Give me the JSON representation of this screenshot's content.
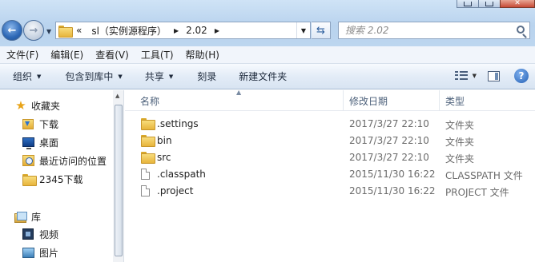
{
  "addressbar": {
    "overflow": "«",
    "crumbs": [
      "sl（实例源程序）",
      "2.02"
    ]
  },
  "search": {
    "placeholder": "搜索 2.02"
  },
  "menu": [
    "文件(F)",
    "编辑(E)",
    "查看(V)",
    "工具(T)",
    "帮助(H)"
  ],
  "commands": {
    "organize": "组织",
    "include_in_library": "包含到库中",
    "share": "共享",
    "burn": "刻录",
    "new_folder": "新建文件夹"
  },
  "nav": {
    "favorites": "收藏夹",
    "downloads": "下载",
    "desktop": "桌面",
    "recent": "最近访问的位置",
    "downloads_2345": "2345下载",
    "libraries": "库",
    "videos": "视频",
    "pictures": "图片"
  },
  "columns": {
    "name": "名称",
    "modified": "修改日期",
    "type": "类型"
  },
  "files": [
    {
      "name": ".settings",
      "modified": "2017/3/27 22:10",
      "type": "文件夹",
      "icon": "folder-icon"
    },
    {
      "name": "bin",
      "modified": "2017/3/27 22:10",
      "type": "文件夹",
      "icon": "folder-icon"
    },
    {
      "name": "src",
      "modified": "2017/3/27 22:10",
      "type": "文件夹",
      "icon": "folder-icon"
    },
    {
      "name": ".classpath",
      "modified": "2015/11/30 16:22",
      "type": "CLASSPATH 文件",
      "icon": "file-icon"
    },
    {
      "name": ".project",
      "modified": "2015/11/30 16:22",
      "type": "PROJECT 文件",
      "icon": "file-icon"
    }
  ]
}
